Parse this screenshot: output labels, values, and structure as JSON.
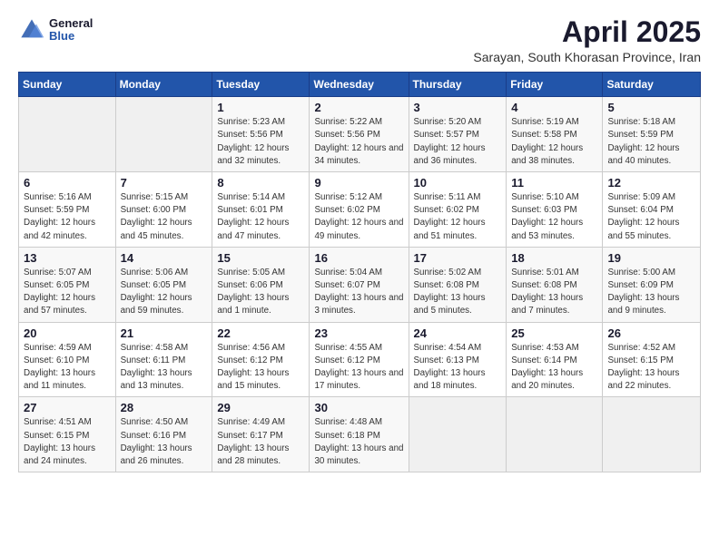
{
  "logo": {
    "general": "General",
    "blue": "Blue"
  },
  "header": {
    "month_year": "April 2025",
    "location": "Sarayan, South Khorasan Province, Iran"
  },
  "weekdays": [
    "Sunday",
    "Monday",
    "Tuesday",
    "Wednesday",
    "Thursday",
    "Friday",
    "Saturday"
  ],
  "weeks": [
    [
      {
        "day": "",
        "sunrise": "",
        "sunset": "",
        "daylight": ""
      },
      {
        "day": "",
        "sunrise": "",
        "sunset": "",
        "daylight": ""
      },
      {
        "day": "1",
        "sunrise": "Sunrise: 5:23 AM",
        "sunset": "Sunset: 5:56 PM",
        "daylight": "Daylight: 12 hours and 32 minutes."
      },
      {
        "day": "2",
        "sunrise": "Sunrise: 5:22 AM",
        "sunset": "Sunset: 5:56 PM",
        "daylight": "Daylight: 12 hours and 34 minutes."
      },
      {
        "day": "3",
        "sunrise": "Sunrise: 5:20 AM",
        "sunset": "Sunset: 5:57 PM",
        "daylight": "Daylight: 12 hours and 36 minutes."
      },
      {
        "day": "4",
        "sunrise": "Sunrise: 5:19 AM",
        "sunset": "Sunset: 5:58 PM",
        "daylight": "Daylight: 12 hours and 38 minutes."
      },
      {
        "day": "5",
        "sunrise": "Sunrise: 5:18 AM",
        "sunset": "Sunset: 5:59 PM",
        "daylight": "Daylight: 12 hours and 40 minutes."
      }
    ],
    [
      {
        "day": "6",
        "sunrise": "Sunrise: 5:16 AM",
        "sunset": "Sunset: 5:59 PM",
        "daylight": "Daylight: 12 hours and 42 minutes."
      },
      {
        "day": "7",
        "sunrise": "Sunrise: 5:15 AM",
        "sunset": "Sunset: 6:00 PM",
        "daylight": "Daylight: 12 hours and 45 minutes."
      },
      {
        "day": "8",
        "sunrise": "Sunrise: 5:14 AM",
        "sunset": "Sunset: 6:01 PM",
        "daylight": "Daylight: 12 hours and 47 minutes."
      },
      {
        "day": "9",
        "sunrise": "Sunrise: 5:12 AM",
        "sunset": "Sunset: 6:02 PM",
        "daylight": "Daylight: 12 hours and 49 minutes."
      },
      {
        "day": "10",
        "sunrise": "Sunrise: 5:11 AM",
        "sunset": "Sunset: 6:02 PM",
        "daylight": "Daylight: 12 hours and 51 minutes."
      },
      {
        "day": "11",
        "sunrise": "Sunrise: 5:10 AM",
        "sunset": "Sunset: 6:03 PM",
        "daylight": "Daylight: 12 hours and 53 minutes."
      },
      {
        "day": "12",
        "sunrise": "Sunrise: 5:09 AM",
        "sunset": "Sunset: 6:04 PM",
        "daylight": "Daylight: 12 hours and 55 minutes."
      }
    ],
    [
      {
        "day": "13",
        "sunrise": "Sunrise: 5:07 AM",
        "sunset": "Sunset: 6:05 PM",
        "daylight": "Daylight: 12 hours and 57 minutes."
      },
      {
        "day": "14",
        "sunrise": "Sunrise: 5:06 AM",
        "sunset": "Sunset: 6:05 PM",
        "daylight": "Daylight: 12 hours and 59 minutes."
      },
      {
        "day": "15",
        "sunrise": "Sunrise: 5:05 AM",
        "sunset": "Sunset: 6:06 PM",
        "daylight": "Daylight: 13 hours and 1 minute."
      },
      {
        "day": "16",
        "sunrise": "Sunrise: 5:04 AM",
        "sunset": "Sunset: 6:07 PM",
        "daylight": "Daylight: 13 hours and 3 minutes."
      },
      {
        "day": "17",
        "sunrise": "Sunrise: 5:02 AM",
        "sunset": "Sunset: 6:08 PM",
        "daylight": "Daylight: 13 hours and 5 minutes."
      },
      {
        "day": "18",
        "sunrise": "Sunrise: 5:01 AM",
        "sunset": "Sunset: 6:08 PM",
        "daylight": "Daylight: 13 hours and 7 minutes."
      },
      {
        "day": "19",
        "sunrise": "Sunrise: 5:00 AM",
        "sunset": "Sunset: 6:09 PM",
        "daylight": "Daylight: 13 hours and 9 minutes."
      }
    ],
    [
      {
        "day": "20",
        "sunrise": "Sunrise: 4:59 AM",
        "sunset": "Sunset: 6:10 PM",
        "daylight": "Daylight: 13 hours and 11 minutes."
      },
      {
        "day": "21",
        "sunrise": "Sunrise: 4:58 AM",
        "sunset": "Sunset: 6:11 PM",
        "daylight": "Daylight: 13 hours and 13 minutes."
      },
      {
        "day": "22",
        "sunrise": "Sunrise: 4:56 AM",
        "sunset": "Sunset: 6:12 PM",
        "daylight": "Daylight: 13 hours and 15 minutes."
      },
      {
        "day": "23",
        "sunrise": "Sunrise: 4:55 AM",
        "sunset": "Sunset: 6:12 PM",
        "daylight": "Daylight: 13 hours and 17 minutes."
      },
      {
        "day": "24",
        "sunrise": "Sunrise: 4:54 AM",
        "sunset": "Sunset: 6:13 PM",
        "daylight": "Daylight: 13 hours and 18 minutes."
      },
      {
        "day": "25",
        "sunrise": "Sunrise: 4:53 AM",
        "sunset": "Sunset: 6:14 PM",
        "daylight": "Daylight: 13 hours and 20 minutes."
      },
      {
        "day": "26",
        "sunrise": "Sunrise: 4:52 AM",
        "sunset": "Sunset: 6:15 PM",
        "daylight": "Daylight: 13 hours and 22 minutes."
      }
    ],
    [
      {
        "day": "27",
        "sunrise": "Sunrise: 4:51 AM",
        "sunset": "Sunset: 6:15 PM",
        "daylight": "Daylight: 13 hours and 24 minutes."
      },
      {
        "day": "28",
        "sunrise": "Sunrise: 4:50 AM",
        "sunset": "Sunset: 6:16 PM",
        "daylight": "Daylight: 13 hours and 26 minutes."
      },
      {
        "day": "29",
        "sunrise": "Sunrise: 4:49 AM",
        "sunset": "Sunset: 6:17 PM",
        "daylight": "Daylight: 13 hours and 28 minutes."
      },
      {
        "day": "30",
        "sunrise": "Sunrise: 4:48 AM",
        "sunset": "Sunset: 6:18 PM",
        "daylight": "Daylight: 13 hours and 30 minutes."
      },
      {
        "day": "",
        "sunrise": "",
        "sunset": "",
        "daylight": ""
      },
      {
        "day": "",
        "sunrise": "",
        "sunset": "",
        "daylight": ""
      },
      {
        "day": "",
        "sunrise": "",
        "sunset": "",
        "daylight": ""
      }
    ]
  ]
}
